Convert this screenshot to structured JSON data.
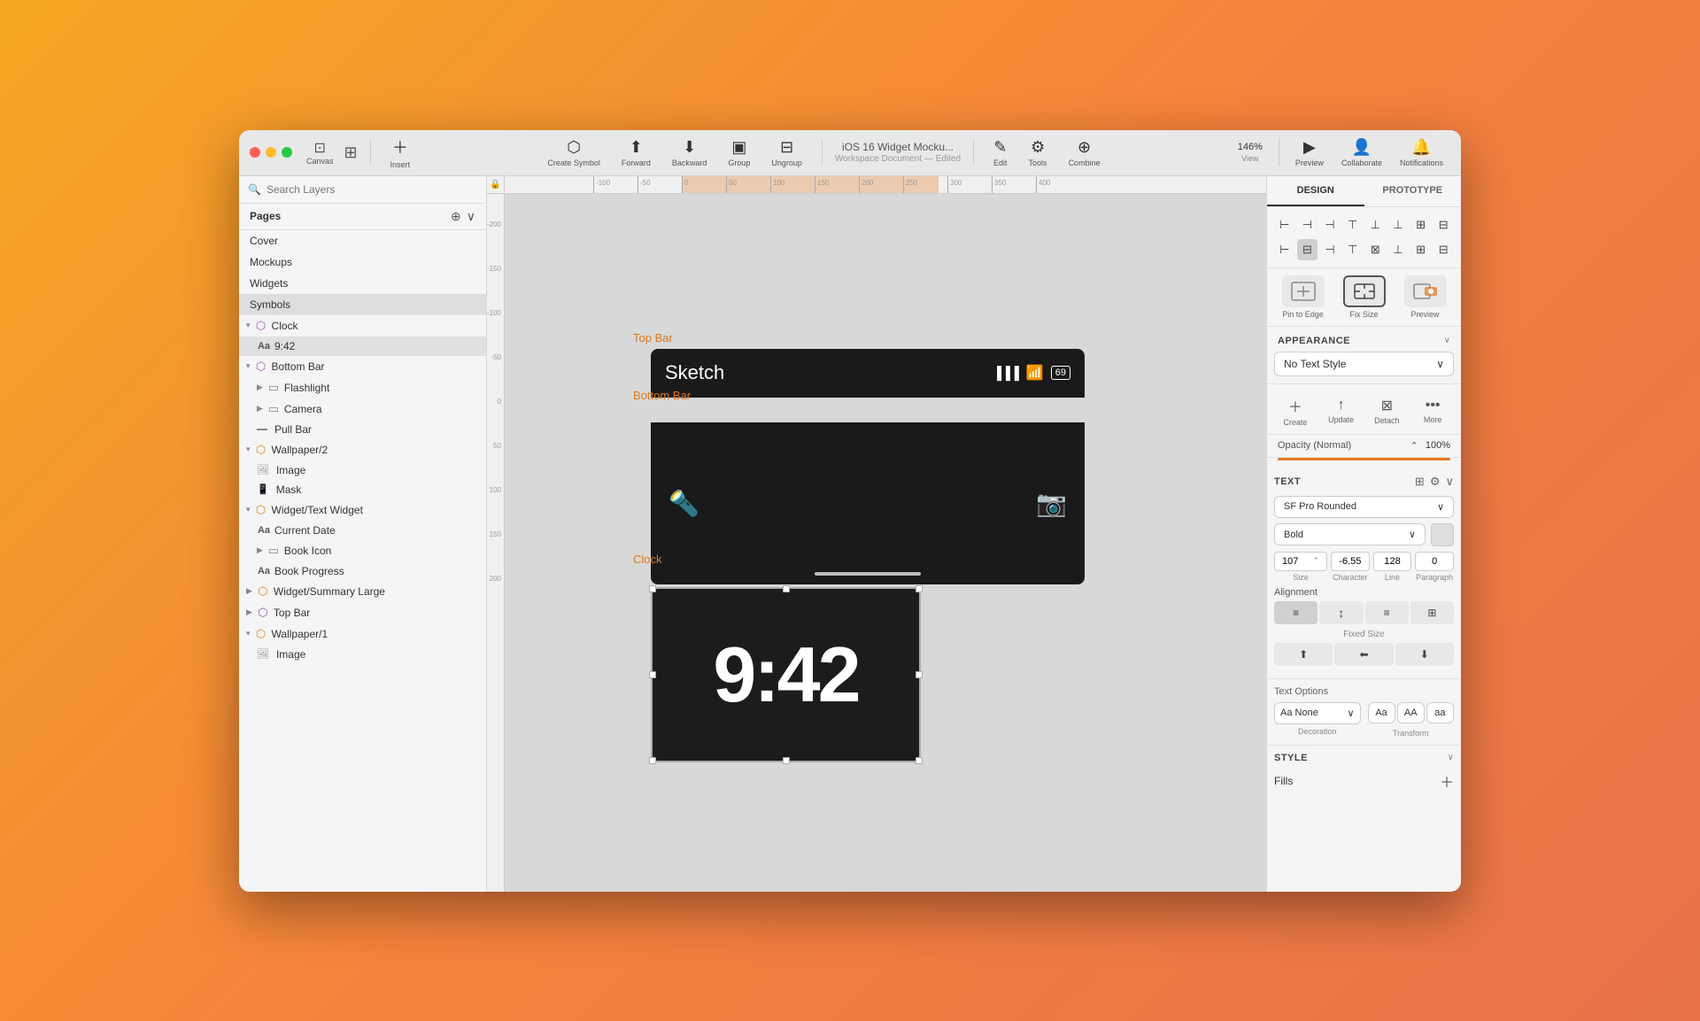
{
  "window": {
    "title": "iOS 16 Widget Mocku...",
    "subtitle": "Workspace Document — Edited"
  },
  "toolbar": {
    "canvas_label": "Canvas",
    "insert_label": "Insert",
    "create_symbol_label": "Create Symbol",
    "forward_label": "Forward",
    "backward_label": "Backward",
    "group_label": "Group",
    "ungroup_label": "Ungroup",
    "edit_label": "Edit",
    "tools_label": "Tools",
    "combine_label": "Combine",
    "zoom_label": "146%",
    "view_label": "View",
    "preview_label": "Preview",
    "collaborate_label": "Collaborate",
    "notifications_label": "Notifications"
  },
  "sidebar": {
    "search_placeholder": "Search Layers",
    "pages_label": "Pages",
    "pages": [
      {
        "name": "Cover"
      },
      {
        "name": "Mockups"
      },
      {
        "name": "Widgets"
      },
      {
        "name": "Symbols",
        "selected": true
      }
    ],
    "layers": [
      {
        "name": "Clock",
        "type": "symbol",
        "indent": 0,
        "expanded": true,
        "chevron": "▾"
      },
      {
        "name": "9:42",
        "type": "text",
        "indent": 1
      },
      {
        "name": "Bottom Bar",
        "type": "symbol",
        "indent": 0,
        "expanded": true,
        "chevron": "▾"
      },
      {
        "name": "Flashlight",
        "type": "group",
        "indent": 1,
        "chevron": "▶"
      },
      {
        "name": "Camera",
        "type": "group",
        "indent": 1,
        "chevron": "▶"
      },
      {
        "name": "Pull Bar",
        "type": "line",
        "indent": 1
      },
      {
        "name": "Wallpaper/2",
        "type": "symbol-orange",
        "indent": 0,
        "expanded": true,
        "chevron": "▾"
      },
      {
        "name": "Image",
        "type": "image",
        "indent": 1
      },
      {
        "name": "Mask",
        "type": "phone",
        "indent": 1
      },
      {
        "name": "Widget/Text Widget",
        "type": "symbol-orange",
        "indent": 0,
        "expanded": true,
        "chevron": "▾"
      },
      {
        "name": "Current Date",
        "type": "text",
        "indent": 1
      },
      {
        "name": "Book Icon",
        "type": "group",
        "indent": 1,
        "chevron": "▶"
      },
      {
        "name": "Book Progress",
        "type": "text",
        "indent": 1
      },
      {
        "name": "Widget/Summary Large",
        "type": "symbol-orange",
        "indent": 0,
        "chevron": "▶"
      },
      {
        "name": "Top Bar",
        "type": "symbol",
        "indent": 0,
        "chevron": "▶"
      },
      {
        "name": "Wallpaper/1",
        "type": "symbol-orange",
        "indent": 0,
        "expanded": true,
        "chevron": "▾"
      },
      {
        "name": "Image",
        "type": "image",
        "indent": 1
      }
    ]
  },
  "canvas": {
    "top_bar_label": "Top Bar",
    "bottom_bar_label": "Bottom Bar",
    "clock_label": "Clock",
    "ios_app_name": "Sketch",
    "clock_time": "9:42"
  },
  "right_panel": {
    "design_tab": "DESIGN",
    "prototype_tab": "PROTOTYPE",
    "appearance": {
      "label": "APPEARANCE",
      "text_style": "No Text Style"
    },
    "text_actions": {
      "create": "Create",
      "update": "Update",
      "detach": "Detach",
      "more": "More"
    },
    "opacity": {
      "label": "Opacity (Normal)",
      "value": "100%"
    },
    "text": {
      "label": "TEXT",
      "font_family": "SF Pro Rounded",
      "font_weight": "Bold",
      "size": "107",
      "character": "-6.55",
      "line": "128",
      "paragraph": "0",
      "size_label": "Size",
      "character_label": "Character",
      "line_label": "Line",
      "paragraph_label": "Paragraph",
      "alignment_label": "Alignment",
      "fixed_size_label": "Fixed Size"
    },
    "text_options": {
      "label": "Text Options",
      "decoration_value": "Aa None",
      "decoration_label": "Decoration",
      "transform_values": [
        "Aa",
        "AA",
        "aa"
      ],
      "transform_label": "Transform"
    },
    "style": {
      "label": "STYLE",
      "fills_label": "Fills"
    },
    "layout_actions": {
      "pin_to_edge": "Pin to Edge",
      "fix_size": "Fix Size",
      "preview": "Preview"
    }
  }
}
